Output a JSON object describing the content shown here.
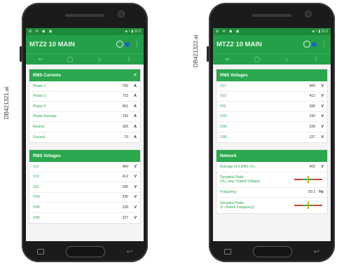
{
  "doc_ids": {
    "left": "DB421321.ai",
    "right": "DB421322.ai"
  },
  "status_bar": {
    "left_icons": "⊞ ✉ ◼ ▣",
    "right_text": "◈ ⌇ ▮ 11:2"
  },
  "app": {
    "title": "MTZ2 10 MAIN",
    "menu_icon": "⋮"
  },
  "tabs": [
    "⇐",
    "◯",
    "⌂",
    "ⅰ"
  ],
  "left": {
    "currents": {
      "header": "RMS Currents",
      "rows": [
        {
          "label": "Phase 1",
          "value": "750",
          "unit": "A"
        },
        {
          "label": "Phase 2",
          "value": "723",
          "unit": "A"
        },
        {
          "label": "Phase 3",
          "value": "951",
          "unit": "A"
        },
        {
          "label": "Phase Average",
          "value": "742",
          "unit": "A"
        },
        {
          "label": "Neutral",
          "value": "165",
          "unit": "A"
        },
        {
          "label": "Ground",
          "value": "70",
          "unit": "A"
        }
      ]
    },
    "voltages": {
      "header": "RMS Voltages",
      "rows": [
        {
          "label": "V12",
          "value": "400",
          "unit": "V"
        },
        {
          "label": "V23",
          "value": "412",
          "unit": "V"
        },
        {
          "label": "V31",
          "value": "395",
          "unit": "V"
        },
        {
          "label": "V1N",
          "value": "230",
          "unit": "V"
        },
        {
          "label": "V2N",
          "value": "228",
          "unit": "V"
        },
        {
          "label": "V3N",
          "value": "227",
          "unit": "V"
        }
      ]
    }
  },
  "right": {
    "voltages": {
      "header": "RMS Voltages",
      "rows": [
        {
          "label": "V12",
          "value": "400",
          "unit": "V"
        },
        {
          "label": "V23",
          "value": "412",
          "unit": "V"
        },
        {
          "label": "V31",
          "value": "395",
          "unit": "V"
        },
        {
          "label": "V1N",
          "value": "230",
          "unit": "V"
        },
        {
          "label": "V2N",
          "value": "228",
          "unit": "V"
        },
        {
          "label": "V3N",
          "value": "227",
          "unit": "V"
        }
      ]
    },
    "network": {
      "header": "Network",
      "average_label": "Average of 3 RMS VLL",
      "average_value": "402",
      "average_unit": "V",
      "deviation_voltage_label_1": "Deviation Ratio",
      "deviation_voltage_label_2": "(VLL avg / Rated Voltage)",
      "frequency_label": "Frequency",
      "frequency_value": "50.1",
      "frequency_unit": "Hz",
      "deviation_freq_label_1": "Deviation Ratio",
      "deviation_freq_label_2": "(F / Rated Frequency)"
    }
  }
}
